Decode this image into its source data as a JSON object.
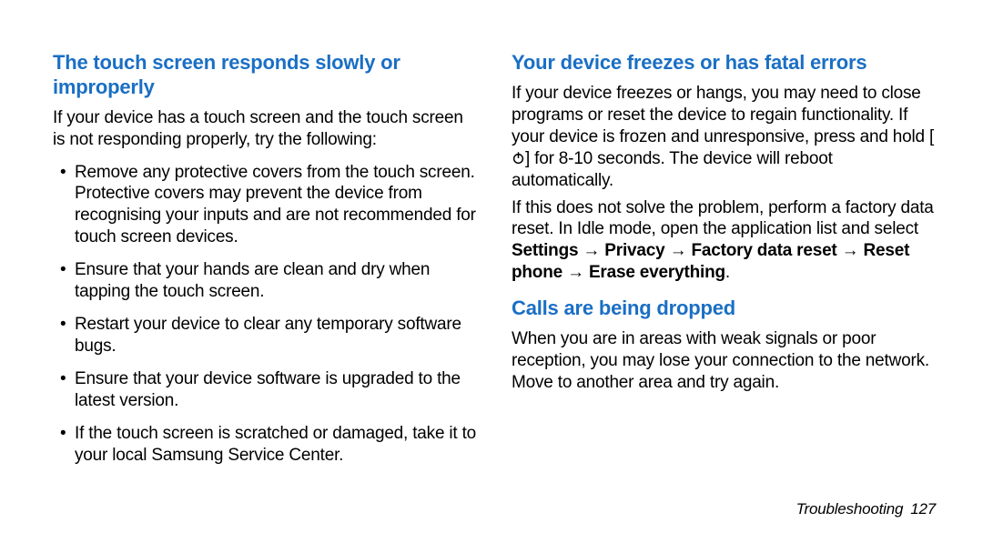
{
  "left": {
    "heading": "The touch screen responds slowly or improperly",
    "intro": "If your device has a touch screen and the touch screen is not responding properly, try the following:",
    "bullets": [
      "Remove any protective covers from the touch screen. Protective covers may prevent the device from recognising your inputs and are not recommended for touch screen devices.",
      "Ensure that your hands are clean and dry when tapping the touch screen.",
      "Restart your device to clear any temporary software bugs.",
      "Ensure that your device software is upgraded to the latest version.",
      "If the touch screen is scratched or damaged, take it to your local Samsung Service Center."
    ]
  },
  "right": {
    "heading1": "Your device freezes or has fatal errors",
    "p1a": "If your device freezes or hangs, you may need to close programs or reset the device to regain functionality. If your device is frozen and unresponsive, press and hold [",
    "p1b": "] for 8-10 seconds. The device will reboot automatically.",
    "p2a": "If this does not solve the problem, perform a factory data reset. In Idle mode, open the application list and select ",
    "p2bold": "Settings → Privacy → Factory data reset → Reset phone → Erase everything",
    "p2end": ".",
    "heading2": "Calls are being dropped",
    "p3": "When you are in areas with weak signals or poor reception, you may lose your connection to the network. Move to another area and try again."
  },
  "footer": {
    "section": "Troubleshooting",
    "page": "127"
  }
}
